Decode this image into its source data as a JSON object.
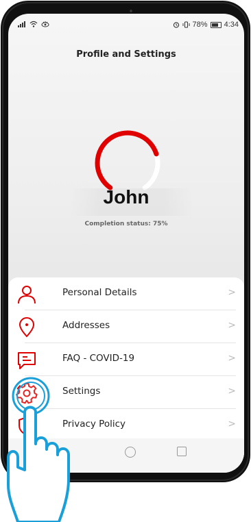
{
  "statusbar": {
    "battery_percent": "78%",
    "time": "4:34",
    "icons": [
      "signal-icon",
      "wifi-icon",
      "eye-icon",
      "alarm-icon",
      "vibrate-icon",
      "battery-icon"
    ]
  },
  "header": {
    "title": "Profile and Settings"
  },
  "profile": {
    "name": "John",
    "completion_text": "Completion status: 75%",
    "completion_value": 0.75
  },
  "menu": {
    "items": [
      {
        "label": "Personal Details",
        "icon": "person-icon"
      },
      {
        "label": "Addresses",
        "icon": "location-pin-icon"
      },
      {
        "label": "FAQ - COVID-19",
        "icon": "message-icon"
      },
      {
        "label": "Settings",
        "icon": "gear-icon"
      },
      {
        "label": "Privacy Policy",
        "icon": "shield-icon"
      }
    ],
    "chevron": ">"
  },
  "colors": {
    "accent": "#e00000",
    "hand": "#1a9fd8"
  }
}
